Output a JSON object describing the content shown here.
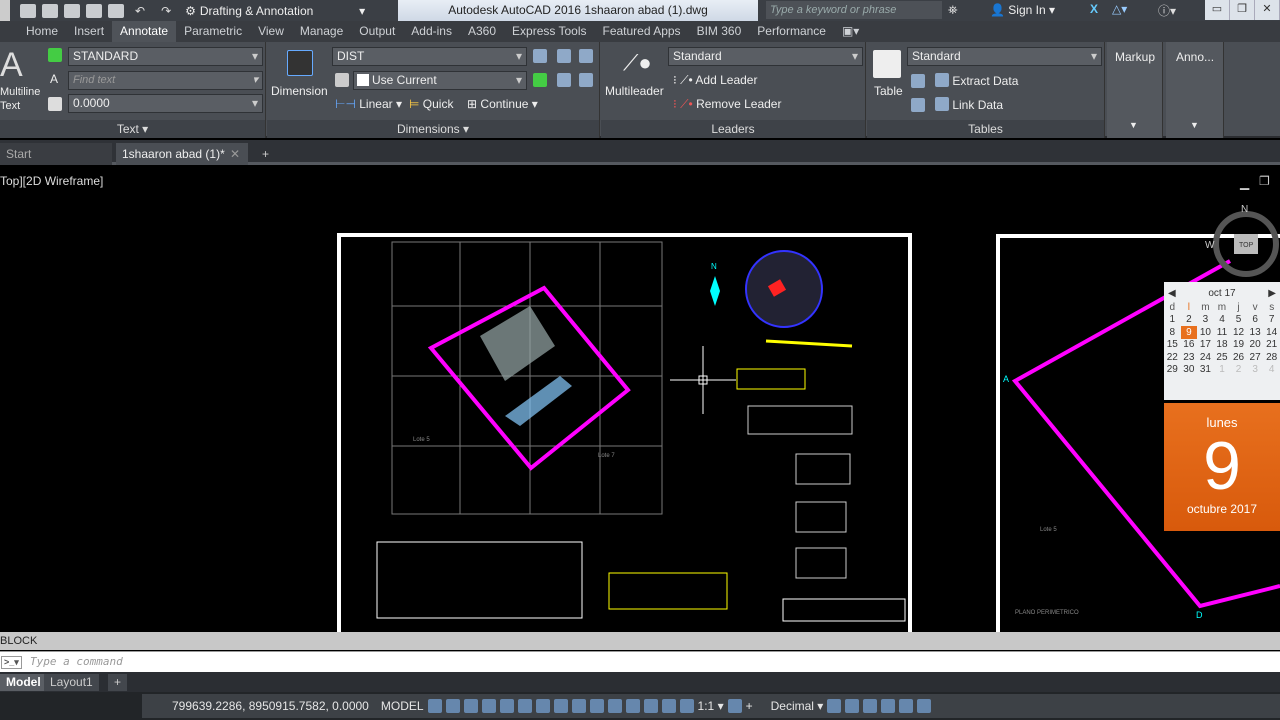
{
  "titlebar": {
    "workspace": "Drafting & Annotation",
    "app_title": "Autodesk AutoCAD 2016   1shaaron abad (1).dwg",
    "search_placeholder": "Type a keyword or phrase",
    "sign_in": "Sign In"
  },
  "tabs": [
    "Home",
    "Insert",
    "Annotate",
    "Parametric",
    "View",
    "Manage",
    "Output",
    "Add-ins",
    "A360",
    "Express Tools",
    "Featured Apps",
    "BIM 360",
    "Performance"
  ],
  "active_tab": "Annotate",
  "ribbon": {
    "text": {
      "big_button": "Multiline Text",
      "style": "STANDARD",
      "find_placeholder": "Find text",
      "height": "0.0000",
      "title": "Text"
    },
    "dimensions": {
      "big_button": "Dimension",
      "style": "DIST",
      "layer": "Use Current",
      "linear": "Linear",
      "quick": "Quick",
      "continue": "Continue",
      "title": "Dimensions"
    },
    "leaders": {
      "big_button": "Multileader",
      "style": "Standard",
      "add": "Add Leader",
      "remove": "Remove Leader",
      "title": "Leaders"
    },
    "tables": {
      "big_button": "Table",
      "style": "Standard",
      "extract": "Extract Data",
      "link": "Link Data",
      "title": "Tables"
    },
    "markup": "Markup",
    "anno": "Anno..."
  },
  "doc_tabs": {
    "start": "Start",
    "active": "1shaaron abad (1)*"
  },
  "viewport_label": "Top][2D Wireframe]",
  "viewcube": {
    "north": "N",
    "west": "W",
    "top": "TOP"
  },
  "drawing": {
    "north": "N",
    "lote_a": "Lote 5",
    "lote_b": "Lote 7",
    "lote_c": "Lote 5",
    "plan_title": "PLANO PERIMETRICO",
    "marker_a": "A",
    "marker_d": "D"
  },
  "command": {
    "history": "BLOCK",
    "placeholder": "Type a command"
  },
  "layout_tabs": [
    "Model",
    "Layout1"
  ],
  "status": {
    "coords": "799639.2286, 8950915.7582, 0.0000",
    "space": "MODEL",
    "scale": "1:1",
    "units": "Decimal"
  },
  "calendar": {
    "month": "oct 17",
    "days": [
      "d",
      "l",
      "m",
      "m",
      "j",
      "v",
      "s"
    ],
    "weeks": [
      [
        "1",
        "2",
        "3",
        "4",
        "5",
        "6",
        "7"
      ],
      [
        "8",
        "9",
        "10",
        "11",
        "12",
        "13",
        "14"
      ],
      [
        "15",
        "16",
        "17",
        "18",
        "19",
        "20",
        "21"
      ],
      [
        "22",
        "23",
        "24",
        "25",
        "26",
        "27",
        "28"
      ],
      [
        "29",
        "30",
        "31",
        "1",
        "2",
        "3",
        "4"
      ]
    ],
    "selected": "9",
    "weekday": "lunes",
    "day": "9",
    "month_year": "octubre 2017"
  },
  "colors": {
    "accent_orange": "#e8701e",
    "polyline_magenta": "#ff00ff",
    "ribbon": "#4a4e54"
  }
}
